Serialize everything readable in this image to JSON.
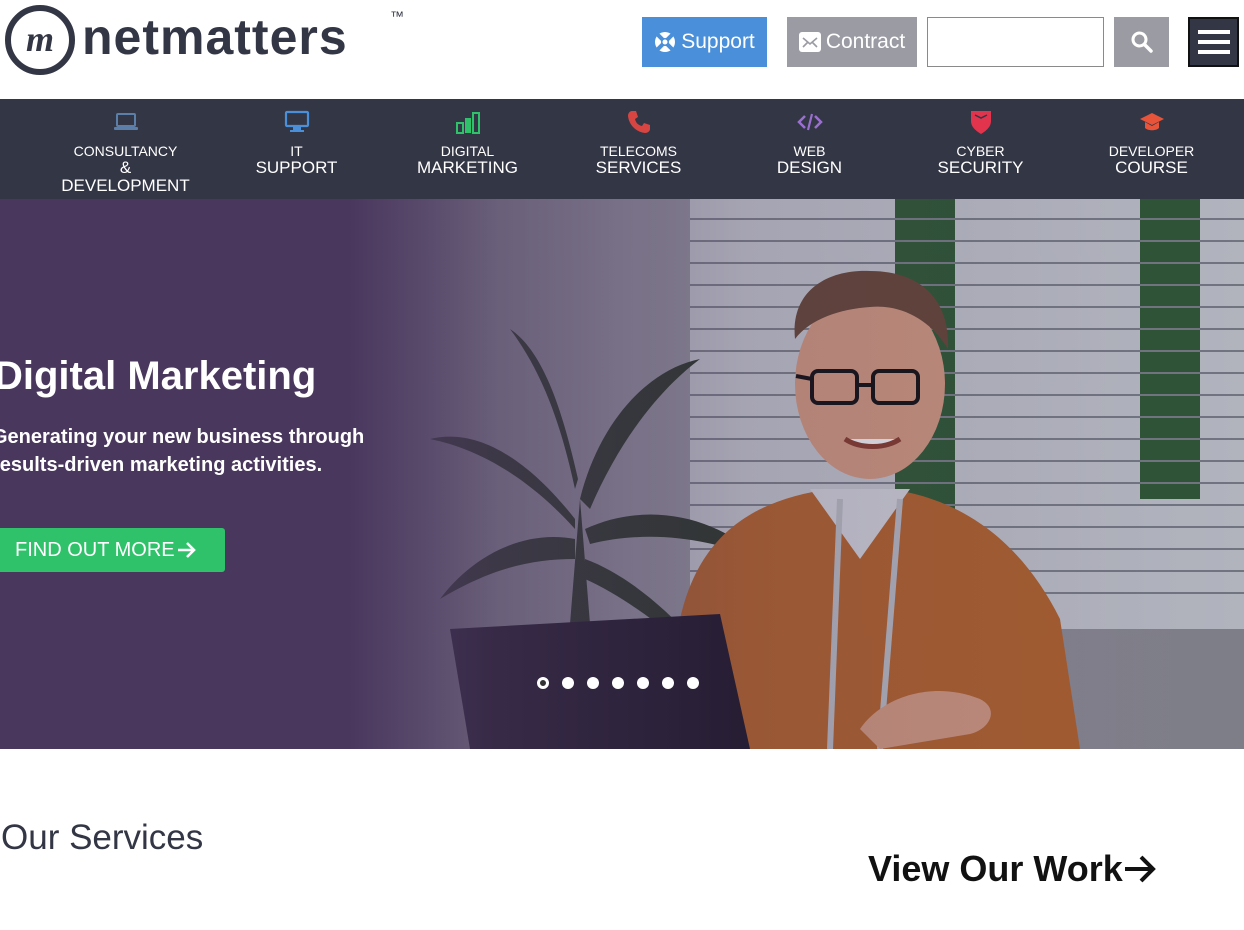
{
  "brand": {
    "name": "netmatters",
    "tm": "™",
    "mark": "m"
  },
  "header": {
    "support_label": "Support",
    "contract_label": "Contract",
    "search_value": "",
    "colors": {
      "support": "#4a8fd9",
      "contract": "#9a9ba3",
      "menu": "#333645"
    }
  },
  "nav": {
    "items": [
      {
        "l1": "CONSULTANCY",
        "l2": "&",
        "l3": "DEVELOPMENT",
        "icon": "laptop-icon",
        "color": "#5b7fa8"
      },
      {
        "l1": "IT",
        "l2": "SUPPORT",
        "icon": "monitor-icon",
        "color": "#4a8fd9"
      },
      {
        "l1": "DIGITAL",
        "l2": "MARKETING",
        "icon": "bar-chart-icon",
        "color": "#2fc26a"
      },
      {
        "l1": "TELECOMS",
        "l2": "SERVICES",
        "icon": "phone-icon",
        "color": "#d64541"
      },
      {
        "l1": "WEB",
        "l2": "DESIGN",
        "icon": "code-icon",
        "color": "#9b6fd0"
      },
      {
        "l1": "CYBER",
        "l2": "SECURITY",
        "icon": "shield-icon",
        "color": "#e3344e"
      },
      {
        "l1": "DEVELOPER",
        "l2": "COURSE",
        "icon": "graduation-cap-icon",
        "color": "#e8543a"
      }
    ]
  },
  "hero": {
    "title": "Digital Marketing",
    "subtitle_line1": "Generating your new business through",
    "subtitle_line2": "results-driven marketing activities.",
    "cta_label": "FIND OUT MORE",
    "cta_color": "#2fc26a",
    "slide_count": 7,
    "active_slide": 1
  },
  "sections": {
    "services_title": "Our Services",
    "view_work_label": "View Our Work"
  }
}
